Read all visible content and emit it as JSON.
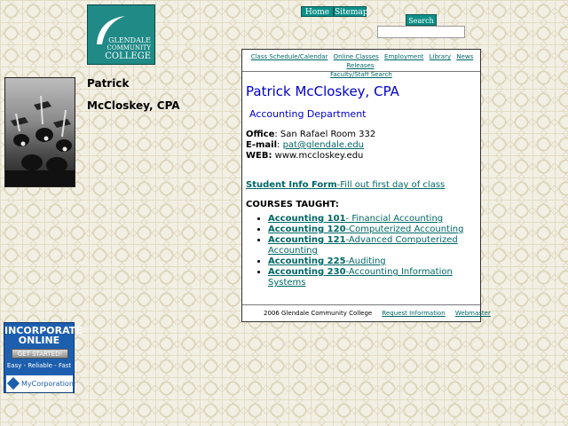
{
  "logo": {
    "line1": "GLENDALE",
    "line2": "COMMUNITY",
    "line3": "COLLEGE"
  },
  "top_nav": {
    "home": "Home",
    "sitemap": "Sitemap",
    "search_button": "Search",
    "search_value": ""
  },
  "sidebar": {
    "name_first": "Patrick",
    "name_last": "McCloskey, CPA"
  },
  "main": {
    "nav_links": [
      "Class Schedule/Calendar",
      "Online Classes",
      "Employment",
      "Library",
      "News Releases",
      "Faculty/Staff Search"
    ],
    "title": "Patrick McCloskey, CPA",
    "department": "Accounting Department",
    "office_label": "Office",
    "office_value": ": San Rafael Room 332",
    "email_label": "E-mail",
    "email_value": "pat@glendale.edu",
    "web_label": "WEB:",
    "web_value": " www.mccloskey.edu",
    "student_form_bold": "Student Info Form",
    "student_form_rest": "-Fill out first day of class",
    "courses_heading": "COURSES TAUGHT:",
    "courses": [
      {
        "code": "Accounting 101",
        "name": "- Financial Accounting"
      },
      {
        "code": "Accounting 120",
        "name": "-Computerized Accounting"
      },
      {
        "code": "Accounting 121",
        "name": "-Advanced Computerized Accounting"
      },
      {
        "code": "Accounting 225",
        "name": "-Auditing"
      },
      {
        "code": "Accounting 230",
        "name": "-Accounting Information Systems"
      }
    ],
    "footer_copyright": "2006 Glendale Community College",
    "footer_request": "Request Information",
    "footer_webmaster": "Webmaster"
  },
  "ad": {
    "line1": "INCORPORATE",
    "line2": "ONLINE",
    "cta": "GET STARTED!",
    "tagline": "Easy - Reliable - Fast",
    "brand": "MyCorporation"
  }
}
